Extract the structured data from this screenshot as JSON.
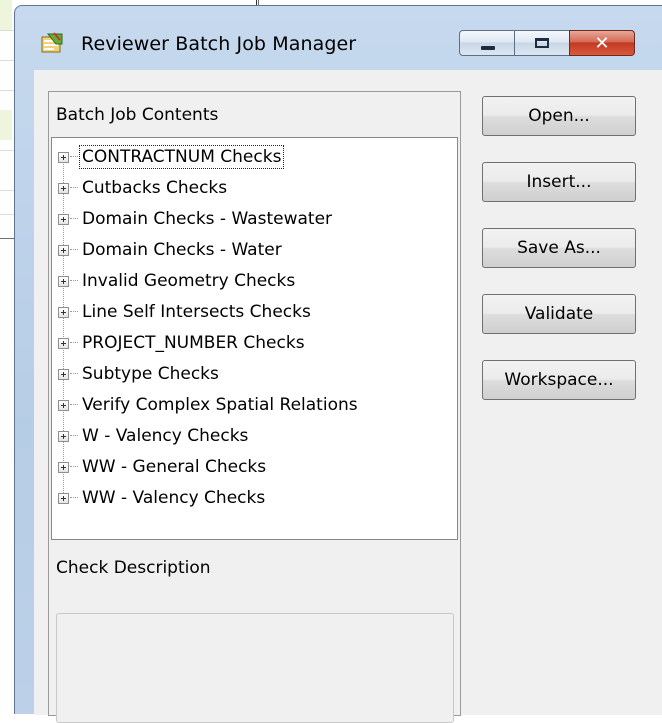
{
  "window": {
    "title": "Reviewer Batch Job Manager"
  },
  "contents": {
    "label": "Batch Job Contents",
    "items": [
      {
        "label": "CONTRACTNUM Checks",
        "focused": true
      },
      {
        "label": "Cutbacks Checks"
      },
      {
        "label": "Domain Checks - Wastewater"
      },
      {
        "label": "Domain Checks - Water"
      },
      {
        "label": "Invalid Geometry Checks"
      },
      {
        "label": "Line Self Intersects Checks"
      },
      {
        "label": "PROJECT_NUMBER Checks"
      },
      {
        "label": "Subtype Checks"
      },
      {
        "label": "Verify Complex Spatial Relations"
      },
      {
        "label": "W - Valency Checks"
      },
      {
        "label": "WW - General Checks"
      },
      {
        "label": "WW - Valency Checks"
      }
    ]
  },
  "description": {
    "label": "Check Description",
    "value": ""
  },
  "buttons": {
    "open": "Open...",
    "insert": "Insert...",
    "save_as": "Save As...",
    "validate": "Validate",
    "workspace": "Workspace..."
  },
  "colors": {
    "title_bar": "#b6cde6",
    "close_button": "#c23a22",
    "client_bg": "#f0f0f0"
  },
  "icons": {
    "app": "batch-job-icon",
    "minimize": "minimize-icon",
    "maximize": "maximize-icon",
    "close": "close-icon",
    "expand": "expand-plus-icon"
  }
}
